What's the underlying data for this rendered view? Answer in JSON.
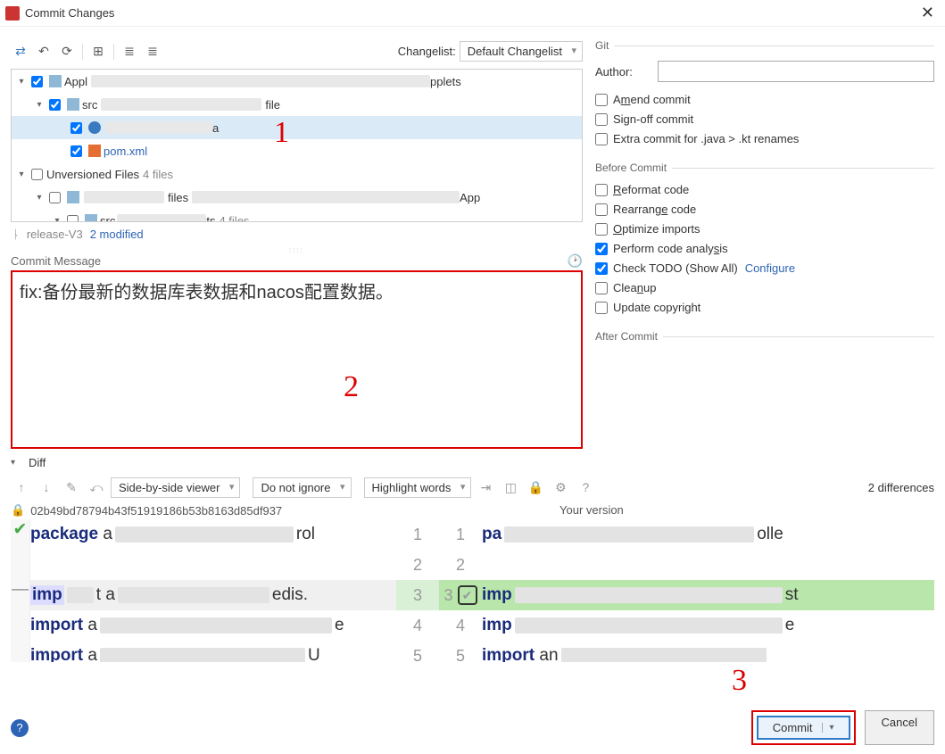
{
  "title": "Commit Changes",
  "toolbar": {
    "changelist_label": "Changelist:",
    "changelist_value": "Default Changelist"
  },
  "tree": {
    "row1": {
      "label": "Appl",
      "suffix": "pplets"
    },
    "row2": {
      "label": "src",
      "suffix": "file"
    },
    "row3": {
      "label": "a"
    },
    "row4": {
      "label": "pom.xml"
    },
    "row5": {
      "label": "Unversioned Files",
      "count": "4 files"
    },
    "row6": {
      "label": "files",
      "suffix": "App"
    },
    "row7": {
      "label": "src",
      "mid": "ts",
      "count": "4 files"
    }
  },
  "status": {
    "branch": "release-V3",
    "mod": "2 modified"
  },
  "commit_message": {
    "label": "Commit Message",
    "value": "fix:备份最新的数据库表数据和nacos配置数据。"
  },
  "git": {
    "header": "Git",
    "author_label": "Author:",
    "amend": "Amend commit",
    "signoff": "Sign-off commit",
    "extra": "Extra commit for .java > .kt renames"
  },
  "before": {
    "header": "Before Commit",
    "reformat": "Reformat code",
    "rearrange": "Rearrange code",
    "optimize": "Optimize imports",
    "analysis": "Perform code analysis",
    "todo": "Check TODO (Show All)",
    "configure": "Configure",
    "cleanup": "Cleanup",
    "copyright": "Update copyright"
  },
  "after": {
    "header": "After Commit"
  },
  "diff": {
    "label": "Diff",
    "viewer": "Side-by-side viewer",
    "ignore": "Do not ignore",
    "highlight": "Highlight words",
    "count": "2 differences",
    "hash": "02b49bd78794b43f51919186b53b8163d85df937",
    "your": "Your version",
    "kw_package": "package",
    "kw_import": "import",
    "kw_imp": "imp",
    "txt_rol": "rol",
    "txt_redis": "edis.",
    "txt_U": "U",
    "txt_olle": "olle",
    "txt_he": "e"
  },
  "buttons": {
    "commit": "Commit",
    "cancel": "Cancel"
  },
  "annot": {
    "a1": "1",
    "a2": "2",
    "a3": "3"
  }
}
